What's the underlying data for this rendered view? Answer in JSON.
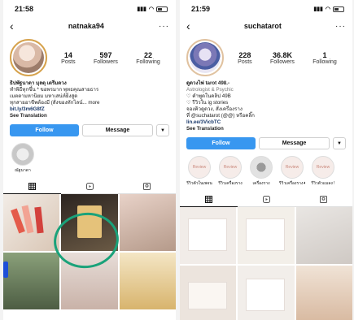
{
  "profiles": [
    {
      "time": "21:58",
      "username": "natnaka94",
      "posts": "14",
      "posts_label": "Posts",
      "followers": "597",
      "followers_label": "Followers",
      "following": "22",
      "following_label": "Following",
      "bio_name": "ธิปพัฐนาดา มุลตุ เตรีมดวง",
      "bio_1": "ทำพิธีทุกขึ้น * ขอพรมาก พุทธคุณสายธาร",
      "bio_2": "เมตตามหานิยม มหาเสน่ห์ยิ่งสูด",
      "bio_3": "ทุกสายอาชีพต้องมี (สั่งของทักไลน์... more",
      "link": "bit.ly/3m6G8fZ",
      "translate": "See Translation",
      "follow": "Follow",
      "message": "Message",
      "highlights": [
        {
          "label": "ณัฐนาดา"
        }
      ]
    },
    {
      "time": "21:59",
      "username": "suchatarot",
      "posts": "228",
      "posts_label": "Posts",
      "followers": "36.8K",
      "followers_label": "Followers",
      "following": "1",
      "following_label": "Following",
      "bio_name": "ดูดวงไพ่ tarot 498.-",
      "bio_sub": "Astrologist & Psychic",
      "bio_1": "♡ คำพูดในคลิป 49B",
      "bio_2": "♡ รีวิวใน ig stories",
      "bio_3": "จองคิวดูดวง, สั่งเครื่องราง",
      "bio_4": "ที่ @suchatarot (@@) หรือคลิ๊ก",
      "link": "lin.ee/3VicbTC",
      "translate": "See Translation",
      "follow": "Follow",
      "message": "Message",
      "highlights": [
        {
          "label": "รีวิวตัวในเพจน"
        },
        {
          "label": "รีวิวเครื่องราง"
        },
        {
          "label": "เครื่องราง"
        },
        {
          "label": "รีวิวเครื่องราง✦"
        },
        {
          "label": "รีวิวตัวแมลง !"
        }
      ]
    }
  ],
  "colors": {
    "accent": "#3897f0",
    "ring": "#1aa27a"
  }
}
